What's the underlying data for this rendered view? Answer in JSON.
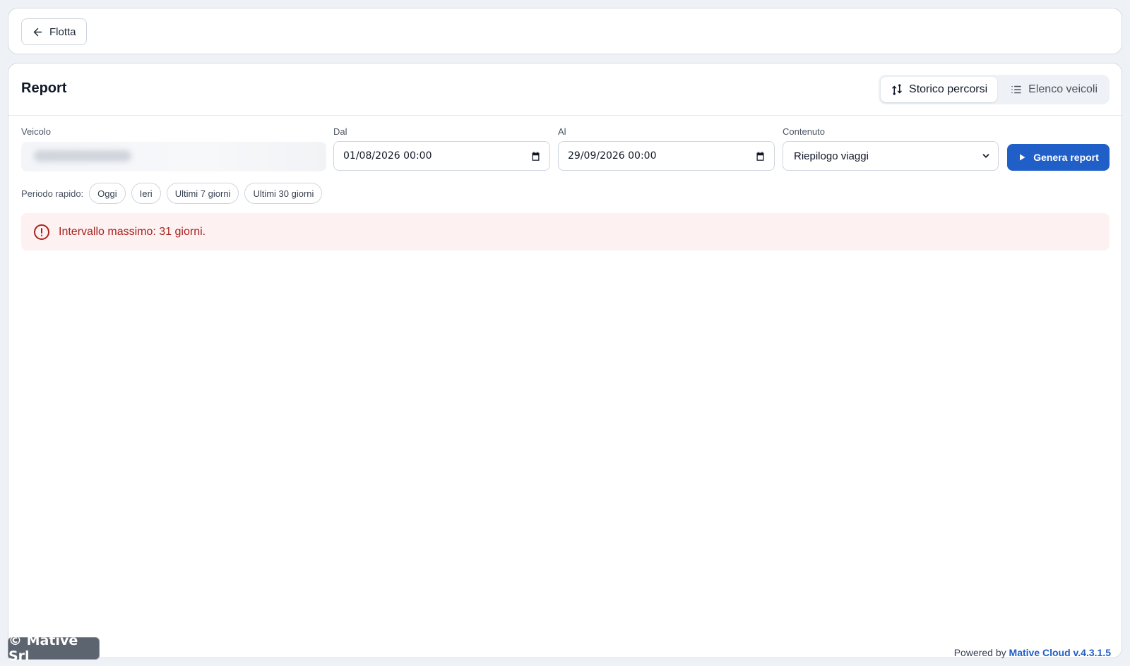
{
  "topbar": {
    "back_label": "Flotta"
  },
  "report": {
    "title": "Report",
    "tabs": [
      {
        "label": "Storico percorsi",
        "icon": "route-history-icon",
        "active": true
      },
      {
        "label": "Elenco veicoli",
        "icon": "list-icon",
        "active": false
      }
    ]
  },
  "form": {
    "vehicle_label": "Veicolo",
    "from_label": "Dal",
    "from_value": "01/08/2026 00:00",
    "to_label": "Al",
    "to_value": "29/09/2026 00:00",
    "content_label": "Contenuto",
    "content_value": "Riepilogo viaggi",
    "generate_label": "Genera report"
  },
  "quick_period": {
    "label": "Periodo rapido:",
    "options": [
      "Oggi",
      "Ieri",
      "Ultimi 7 giorni",
      "Ultimi 30 giorni"
    ]
  },
  "alert": {
    "message": "Intervallo massimo: 31 giorni."
  },
  "footer": {
    "copyright": "© Mative Srl",
    "powered_prefix": "Powered by",
    "powered_brand": "Mative Cloud v.4.3.1.5"
  },
  "colors": {
    "primary": "#1f5fc7",
    "error_text": "#a8231f",
    "error_bg": "#fdf1f1"
  }
}
